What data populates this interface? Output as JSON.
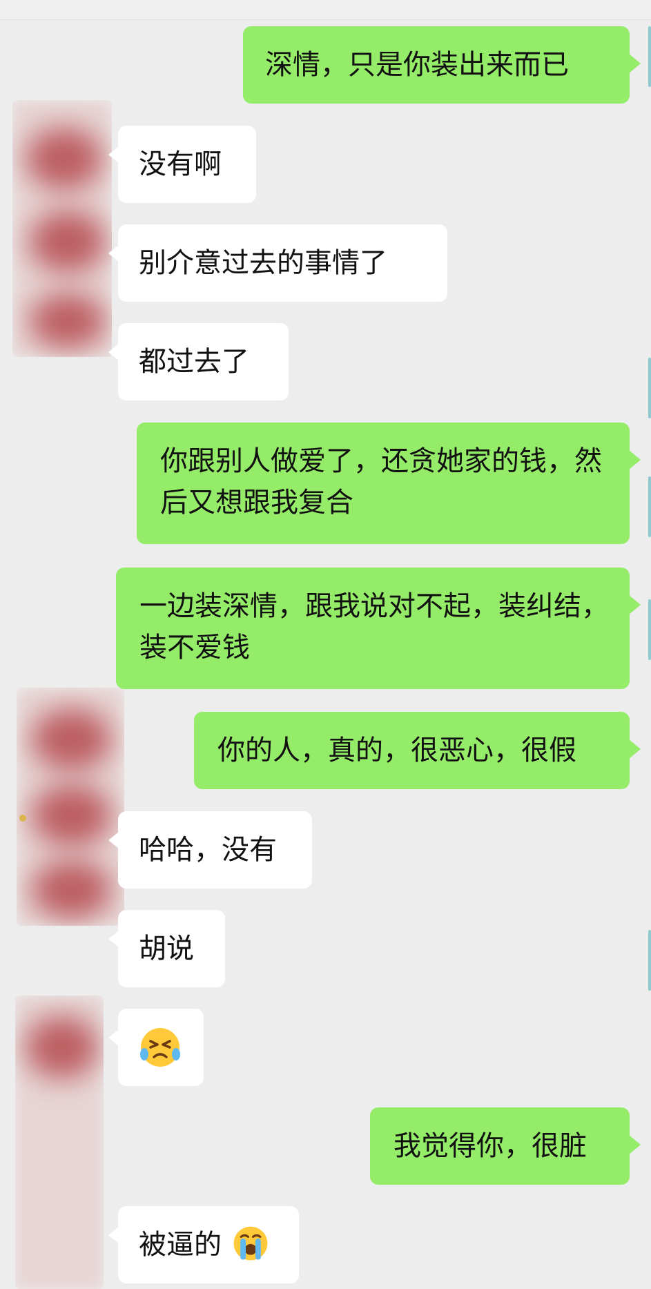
{
  "messages": [
    {
      "id": "m1",
      "side": "me",
      "text": "深情，只是你装出来而已"
    },
    {
      "id": "m2",
      "side": "them",
      "text": "没有啊"
    },
    {
      "id": "m3",
      "side": "them",
      "text": "别介意过去的事情了"
    },
    {
      "id": "m4",
      "side": "them",
      "text": "都过去了"
    },
    {
      "id": "m5",
      "side": "me",
      "text": "你跟别人做爱了，还贪她家的钱，然后又想跟我复合"
    },
    {
      "id": "m6",
      "side": "me",
      "text": "一边装深情，跟我说对不起，装纠结，装不爱钱"
    },
    {
      "id": "m7",
      "side": "me",
      "text": "你的人，真的，很恶心，很假"
    },
    {
      "id": "m8",
      "side": "them",
      "text": "哈哈，没有"
    },
    {
      "id": "m9",
      "side": "them",
      "text": "胡说"
    },
    {
      "id": "m10",
      "side": "them",
      "text": "",
      "emoji": "angry-crying-emoji"
    },
    {
      "id": "m11",
      "side": "me",
      "text": "我觉得你，很脏"
    },
    {
      "id": "m12",
      "side": "them",
      "text": "被逼的",
      "emoji": "loudly-crying-emoji"
    }
  ],
  "colors": {
    "background": "#ededed",
    "my_bubble": "#95ec69",
    "their_bubble": "#ffffff",
    "text": "#111111"
  }
}
